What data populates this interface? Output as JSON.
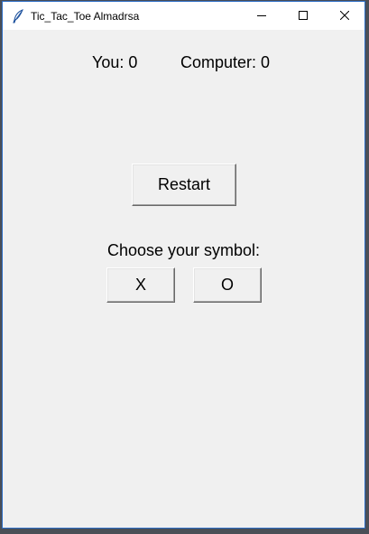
{
  "window": {
    "title": "Tic_Tac_Toe Almadrsa",
    "icon": "feather-icon",
    "controls": {
      "minimize_icon": "minimize-icon",
      "maximize_icon": "maximize-icon",
      "close_icon": "close-icon"
    }
  },
  "scoreboard": {
    "you_label": "You: 0",
    "computer_label": "Computer: 0"
  },
  "actions": {
    "restart_label": "Restart"
  },
  "symbol_choice": {
    "prompt": "Choose your symbol:",
    "options": [
      "X",
      "O"
    ]
  },
  "colors": {
    "window_background": "#f0f0f0",
    "titlebar_background": "#ffffff",
    "window_border": "#2b6cc4"
  }
}
